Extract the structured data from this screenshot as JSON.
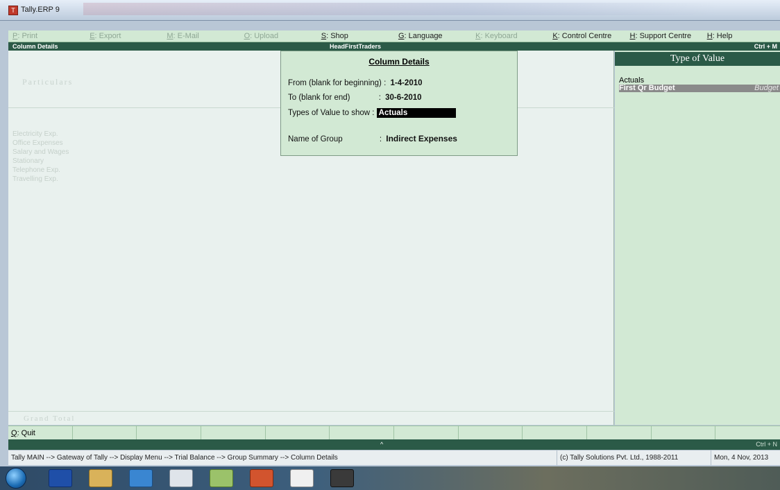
{
  "window": {
    "title": "Tally.ERP 9"
  },
  "button_bar": [
    {
      "key": "P",
      "label": ": Print",
      "enabled": false
    },
    {
      "key": "E",
      "label": ": Export",
      "enabled": false
    },
    {
      "key": "M",
      "label": ": E-Mail",
      "enabled": false
    },
    {
      "key": "O",
      "label": ": Upload",
      "enabled": false
    },
    {
      "key": "S",
      "label": ": Shop",
      "enabled": true
    },
    {
      "key": "G",
      "label": ": Language",
      "enabled": true
    },
    {
      "key": "K",
      "label": ": Keyboard",
      "enabled": false
    },
    {
      "key": "K",
      "label": ": Control Centre",
      "enabled": true
    },
    {
      "key": "H",
      "label": ": Support Centre",
      "enabled": true
    },
    {
      "key": "H",
      "label": ": Help",
      "enabled": true
    }
  ],
  "screen_bar": {
    "left": "Column Details",
    "center": "HeadFirstTraders",
    "right": "Ctrl + M"
  },
  "report": {
    "particulars": "Particulars",
    "rows": [
      "Electricity Exp.",
      "Office Expenses",
      "Salary and Wages",
      "Stationary",
      "Telephone Exp.",
      "Travelling Exp."
    ],
    "grand_total": "Grand Total"
  },
  "popup": {
    "title": "Column Details",
    "from_label": "From (blank for beginning)",
    "from_value": "1-4-2010",
    "to_label": "To (blank for end)",
    "to_value": "30-6-2010",
    "types_label": "Types of Value to show",
    "types_value": "Actuals",
    "group_label": "Name of Group",
    "group_value": "Indirect Expenses",
    "sep": ":"
  },
  "type_of_value": {
    "heading": "Type of Value",
    "options": [
      {
        "label": "Actuals",
        "right": ""
      },
      {
        "label": "First Qr Budget",
        "right": "Budget"
      }
    ]
  },
  "bottom_bar": {
    "key": "Q",
    "label": ": Quit"
  },
  "bottom_strip": {
    "caret": "^",
    "right": "Ctrl + N"
  },
  "status": {
    "breadcrumb": "Tally MAIN --> Gateway of Tally --> Display Menu --> Trial Balance --> Group Summary --> Column Details",
    "copyright": "(c) Tally Solutions Pvt. Ltd., 1988-2011",
    "date": "Mon, 4 Nov, 2013"
  },
  "taskbar_icons": [
    "windows-start-icon",
    "word-icon",
    "explorer-icon",
    "internet-explorer-icon",
    "calculator-icon",
    "media-icon",
    "powerpoint-icon",
    "tally-icon",
    "unknown-app-icon"
  ]
}
